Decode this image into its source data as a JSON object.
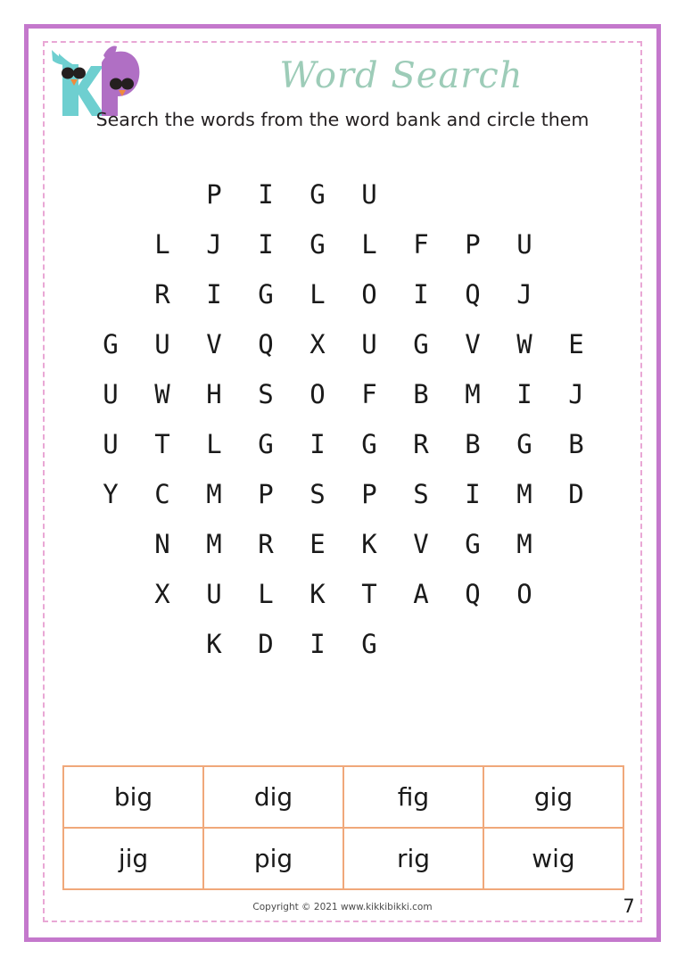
{
  "worksheet": {
    "title": "Word Search",
    "subtitle": "Search the words from the word bank and circle them",
    "page_number": "7",
    "copyright": "Copyright © 2021 www.kikkibikki.com"
  },
  "logo": {
    "letter_k": "K",
    "letter_b": "B",
    "k_color": "#6ecfd0",
    "b_color": "#b06fc4",
    "beak_color": "#f08a3c",
    "sunglasses_color": "#241f1f"
  },
  "colors": {
    "frame_outer": "#c478cc",
    "frame_inner_dashed": "#e9a7d5",
    "title": "#9dccb8",
    "wordbank_border": "#f0a87a",
    "letter": "#1a1a1a"
  },
  "grid": {
    "columns": 10,
    "rows": [
      {
        "offset": 3,
        "letters": [
          "P",
          "I",
          "G",
          "U"
        ]
      },
      {
        "offset": 2,
        "letters": [
          "L",
          "J",
          "I",
          "G",
          "L",
          "F",
          "P",
          "U"
        ]
      },
      {
        "offset": 2,
        "letters": [
          "R",
          "I",
          "G",
          "L",
          "O",
          "I",
          "Q",
          "J"
        ]
      },
      {
        "offset": 1,
        "letters": [
          "G",
          "U",
          "V",
          "Q",
          "X",
          "U",
          "G",
          "V",
          "W",
          "E"
        ]
      },
      {
        "offset": 1,
        "letters": [
          "U",
          "W",
          "H",
          "S",
          "O",
          "F",
          "B",
          "M",
          "I",
          "J"
        ]
      },
      {
        "offset": 1,
        "letters": [
          "U",
          "T",
          "L",
          "G",
          "I",
          "G",
          "R",
          "B",
          "G",
          "B"
        ]
      },
      {
        "offset": 1,
        "letters": [
          "Y",
          "C",
          "M",
          "P",
          "S",
          "P",
          "S",
          "I",
          "M",
          "D"
        ]
      },
      {
        "offset": 2,
        "letters": [
          "N",
          "M",
          "R",
          "E",
          "K",
          "V",
          "G",
          "M"
        ]
      },
      {
        "offset": 2,
        "letters": [
          "X",
          "U",
          "L",
          "K",
          "T",
          "A",
          "Q",
          "O"
        ]
      },
      {
        "offset": 3,
        "letters": [
          "K",
          "D",
          "I",
          "G"
        ]
      }
    ]
  },
  "wordbank": {
    "rows": [
      [
        "big",
        "dig",
        "fig",
        "gig"
      ],
      [
        "jig",
        "pig",
        "rig",
        "wig"
      ]
    ]
  }
}
